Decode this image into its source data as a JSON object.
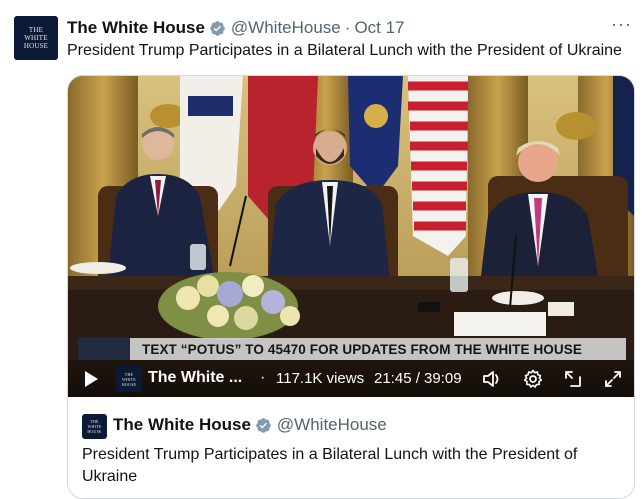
{
  "tweet": {
    "author_name": "The White House",
    "handle": "@WhiteHouse",
    "separator": "·",
    "date": "Oct 17",
    "more_label": "···",
    "text": "President Trump Participates in a Bilateral Lunch with the President of Ukraine"
  },
  "avatar": {
    "line1": "THE",
    "line2": "WHITE",
    "line3": "HOUSE"
  },
  "video": {
    "banner_text": "TEXT “POTUS” TO 45470 FOR UPDATES FROM THE WHITE HOUSE",
    "title": "The White ...",
    "separator": "·",
    "views": "117.1K views",
    "time": "21:45 / 39:09",
    "progress": 0.556
  },
  "card": {
    "author_name": "The White House",
    "handle": "@WhiteHouse",
    "text": "President Trump Participates in a Bilateral Lunch with the President of Ukraine"
  },
  "icons": {
    "verified": "verified-badge-icon",
    "play": "play-icon",
    "volume": "volume-icon",
    "settings": "settings-gear-icon",
    "popout": "popout-icon",
    "fullscreen": "fullscreen-icon"
  },
  "colors": {
    "verified": "#829aab",
    "text": "#0f1419",
    "muted": "#536471",
    "border": "#cfd9de"
  }
}
